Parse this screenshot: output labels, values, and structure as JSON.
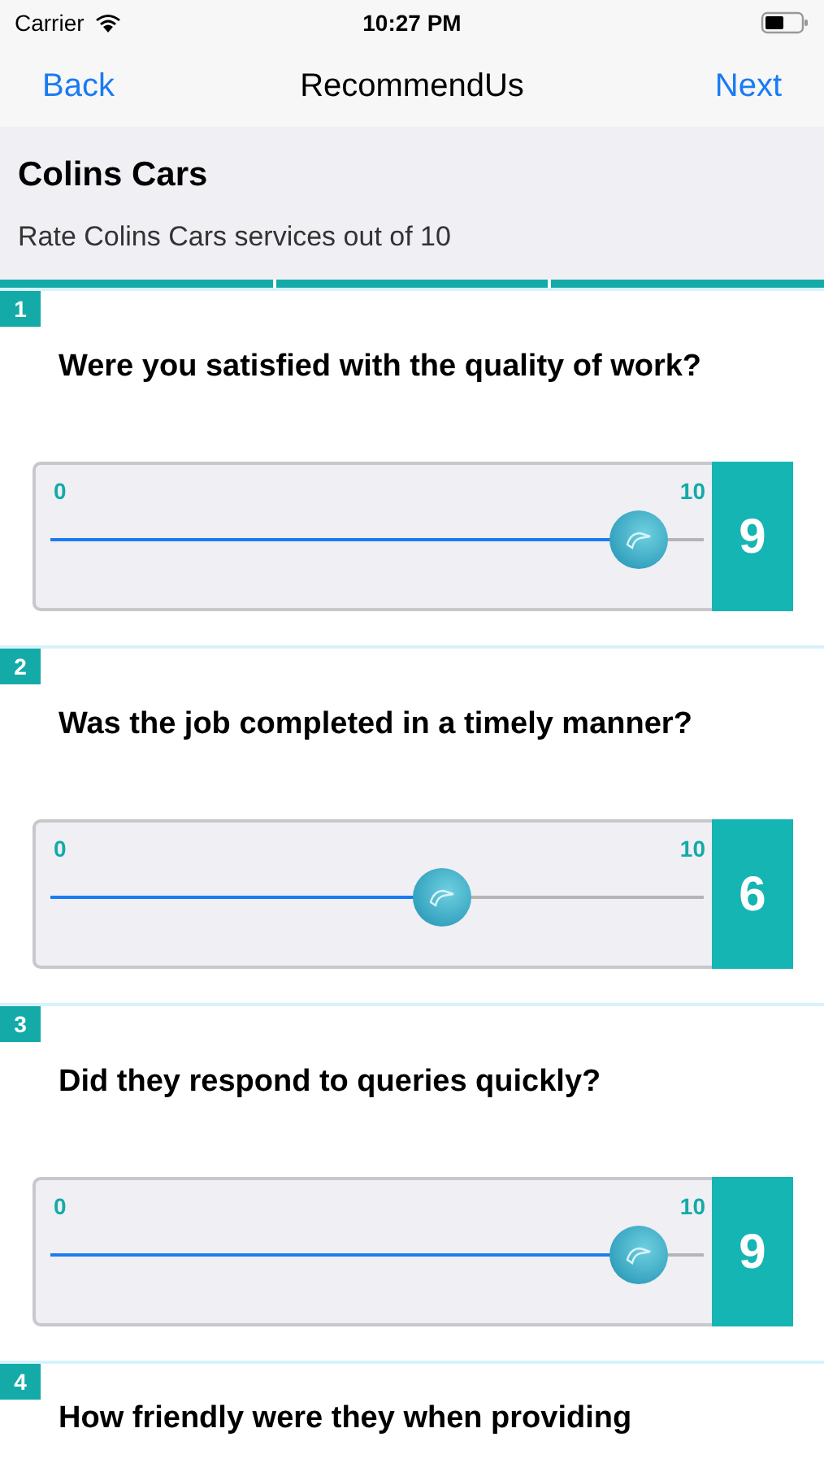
{
  "status_bar": {
    "carrier": "Carrier",
    "time": "10:27 PM"
  },
  "nav": {
    "back": "Back",
    "title": "RecommendUs",
    "next": "Next"
  },
  "header": {
    "title": "Colins Cars",
    "subtitle": "Rate Colins Cars services out of 10"
  },
  "questions": [
    {
      "number": "1",
      "text": "Were you satisfied with the quality of work?",
      "min": "0",
      "max": "10",
      "level": 0.9,
      "value": "9"
    },
    {
      "number": "2",
      "text": "Was the job completed in a timely manner?",
      "min": "0",
      "max": "10",
      "level": 0.6,
      "value": "6"
    },
    {
      "number": "3",
      "text": "Did they respond to queries quickly?",
      "min": "0",
      "max": "10",
      "level": 0.9,
      "value": "9"
    },
    {
      "number": "4",
      "text": "How friendly were they when providing"
    }
  ]
}
